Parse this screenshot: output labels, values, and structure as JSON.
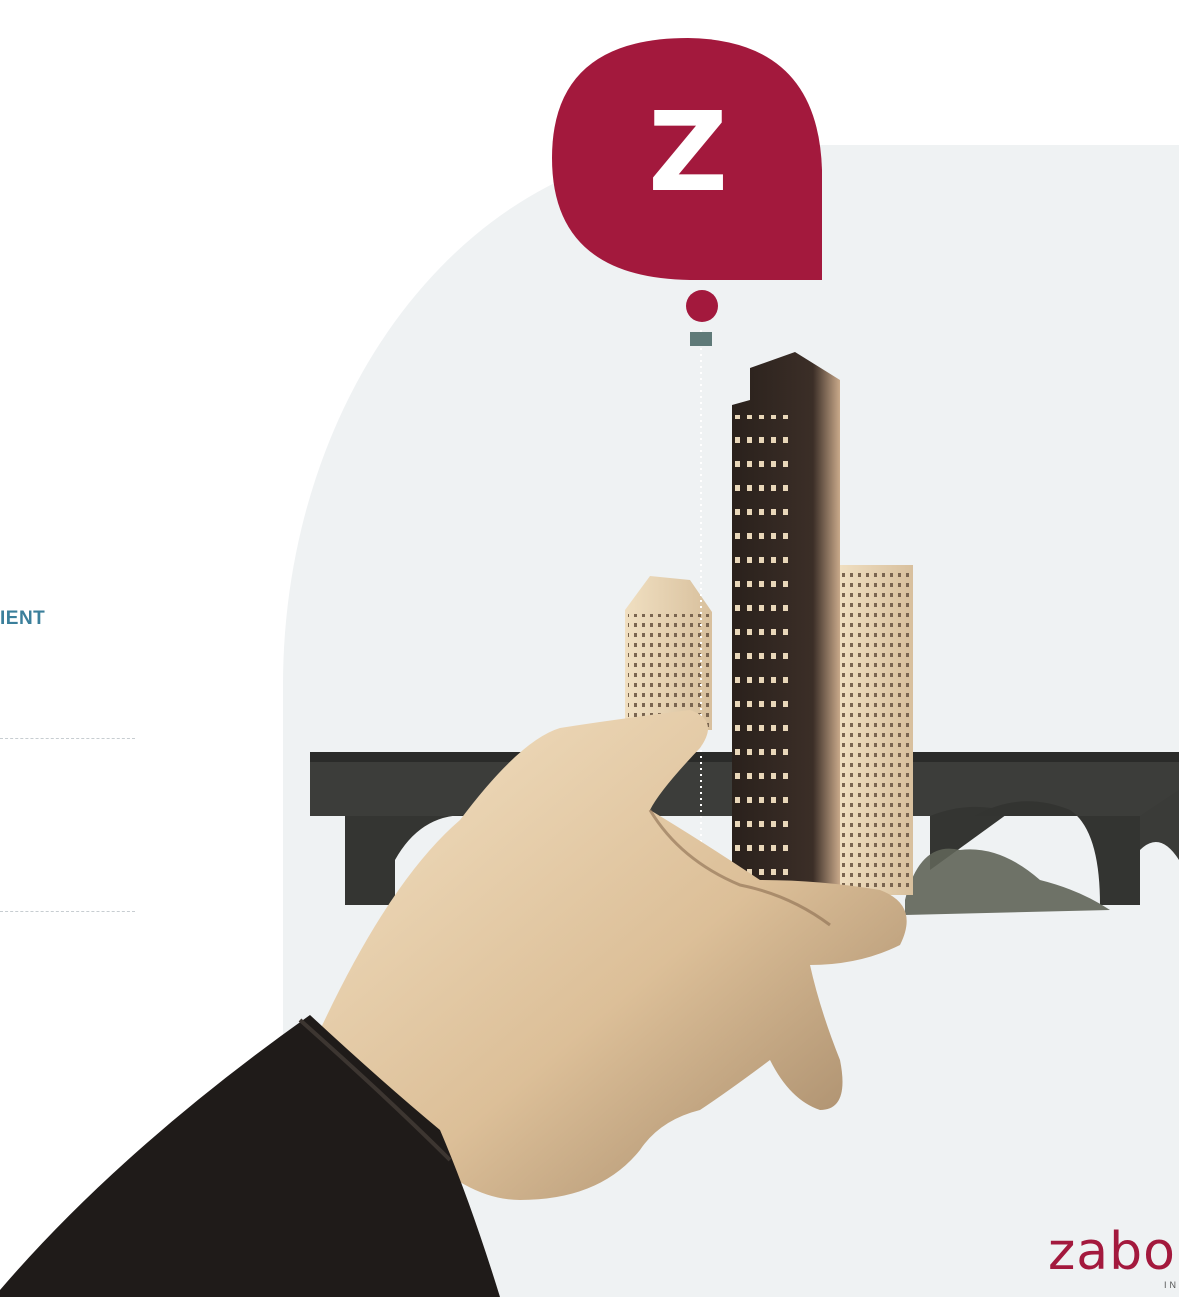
{
  "heading_fragment": "IENT",
  "marker": {
    "letter": "Z",
    "color": "#a3193d"
  },
  "logo": {
    "text": "zabo",
    "subtext": "IN",
    "color": "#a3193d"
  },
  "colors": {
    "accent": "#3b7f9b",
    "panel": "#eff2f3"
  },
  "icons": [
    "map-pin-icon"
  ]
}
